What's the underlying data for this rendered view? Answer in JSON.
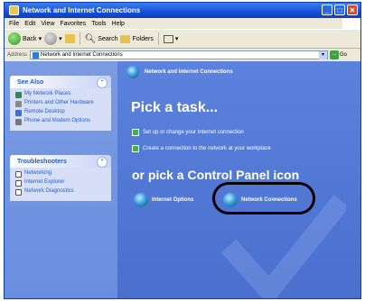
{
  "window": {
    "title": "Network and Internet Connections"
  },
  "menu": [
    "File",
    "Edit",
    "View",
    "Favorites",
    "Tools",
    "Help"
  ],
  "toolbar": {
    "back": "Back",
    "search": "Search",
    "folders": "Folders"
  },
  "address": {
    "label": "Address",
    "value": "Network and Internet Connections",
    "go": "Go"
  },
  "see_also": {
    "title": "See Also",
    "items": [
      "My Network Places",
      "Printers and Other Hardware",
      "Remote Desktop",
      "Phone and Modem Options"
    ]
  },
  "troubleshooters": {
    "title": "Troubleshooters",
    "items": [
      "Networking",
      "Internet Explorer",
      "Network Diagnostics"
    ]
  },
  "main": {
    "category": "Network and Internet Connections",
    "pick_task": "Pick a task...",
    "tasks": [
      "Set up or change your Internet connection",
      "Create a connection to the network at your workplace"
    ],
    "pick_icon": "or pick a Control Panel icon",
    "icons": [
      "Internet Options",
      "Network Connections"
    ]
  }
}
